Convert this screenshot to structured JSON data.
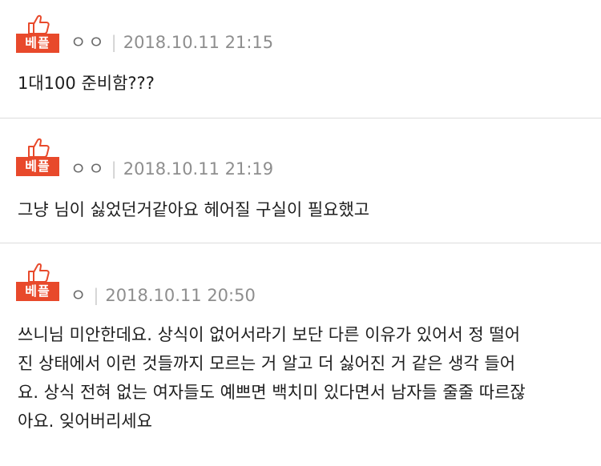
{
  "comments": [
    {
      "badge": "베플",
      "author": "ㅇㅇ",
      "separator": "|",
      "timestamp": "2018.10.11 21:15",
      "text": "1대100 준비함???"
    },
    {
      "badge": "베플",
      "author": "ㅇㅇ",
      "separator": "|",
      "timestamp": "2018.10.11 21:19",
      "text": "그냥 님이 싫었던거같아요 헤어질 구실이 필요했고"
    },
    {
      "badge": "베플",
      "author": "ㅇ",
      "separator": "|",
      "timestamp": "2018.10.11 20:50",
      "text": "쓰니님 미안한데요. 상식이 없어서라기 보단 다른 이유가 있어서 정 떨어\n진 상태에서 이런 것들까지 모르는 거 알고 더 싫어진 거 같은 생각 들어\n요. 상식 전혀 없는 여자들도 예쁘면 백치미 있다면서 남자들 줄줄 따르잖\n아요. 잊어버리세요"
    }
  ],
  "colors": {
    "best_badge": "#e8492b",
    "meta_text": "#8e8e8e",
    "divider": "#dcdcdc"
  },
  "icons": {
    "best": "thumbs-up-icon"
  }
}
